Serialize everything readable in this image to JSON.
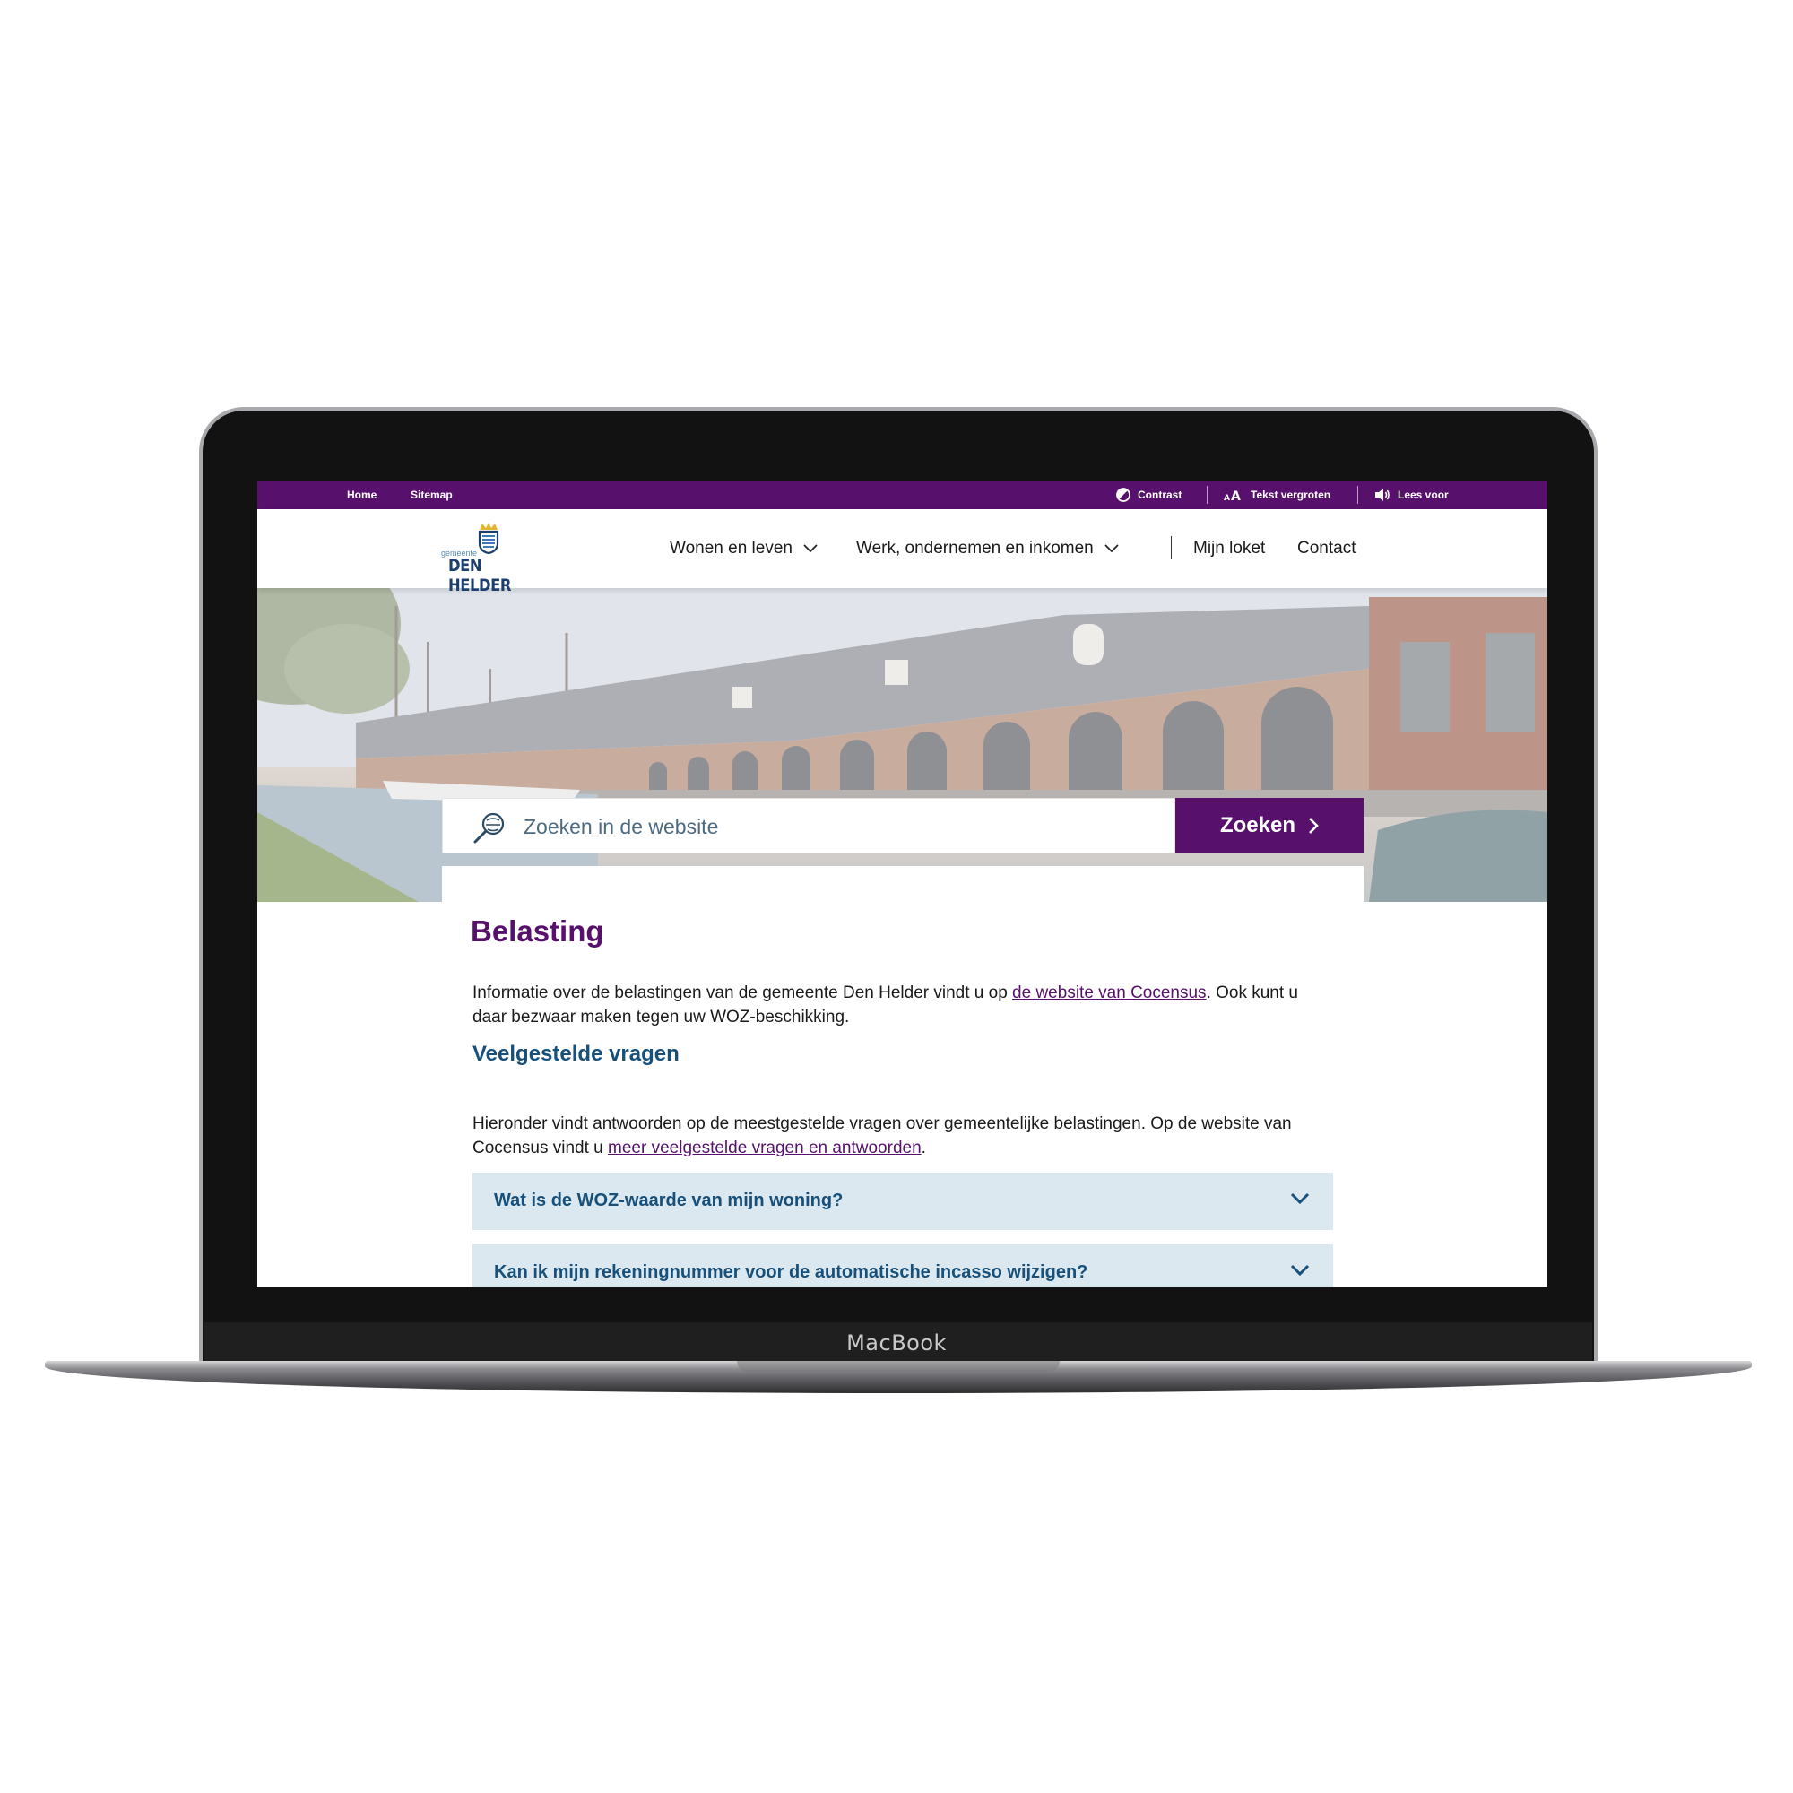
{
  "device": {
    "label": "MacBook"
  },
  "utility_bar": {
    "links": [
      "Home",
      "Sitemap"
    ],
    "tools": [
      {
        "label": "Contrast",
        "icon": "contrast-icon"
      },
      {
        "label": "Tekst vergroten",
        "icon": "text-size-icon"
      },
      {
        "label": "Lees voor",
        "icon": "speaker-icon"
      }
    ]
  },
  "header": {
    "logo": {
      "small": "gemeente",
      "name": "DEN HELDER"
    },
    "nav": [
      {
        "label": "Wonen en leven",
        "has_dropdown": true
      },
      {
        "label": "Werk, ondernemen en inkomen",
        "has_dropdown": true
      },
      {
        "label": "Mijn loket",
        "has_dropdown": false
      },
      {
        "label": "Contact",
        "has_dropdown": false
      }
    ]
  },
  "search": {
    "placeholder": "Zoeken in de website",
    "button_label": "Zoeken"
  },
  "main": {
    "title": "Belasting",
    "intro": {
      "before": "Informatie over de belastingen van de gemeente Den Helder vindt u op ",
      "link": "de website van Cocensus",
      "after": ". Ook kunt u daar bezwaar maken tegen uw WOZ-beschikking."
    },
    "faq_heading": "Veelgestelde vragen",
    "faq_intro": {
      "before": "Hieronder vindt antwoorden op de meestgestelde vragen over gemeentelijke belastingen. Op de website van Cocensus vindt u ",
      "link": "meer veelgestelde vragen en antwoorden",
      "after": "."
    },
    "faq_items": [
      "Wat is de WOZ-waarde van mijn woning?",
      "Kan ik mijn rekeningnummer voor de automatische incasso wijzigen?"
    ]
  },
  "colors": {
    "brand_purple": "#57106b",
    "heading_blue": "#17507a",
    "accordion_bg": "#dbe8ef"
  }
}
